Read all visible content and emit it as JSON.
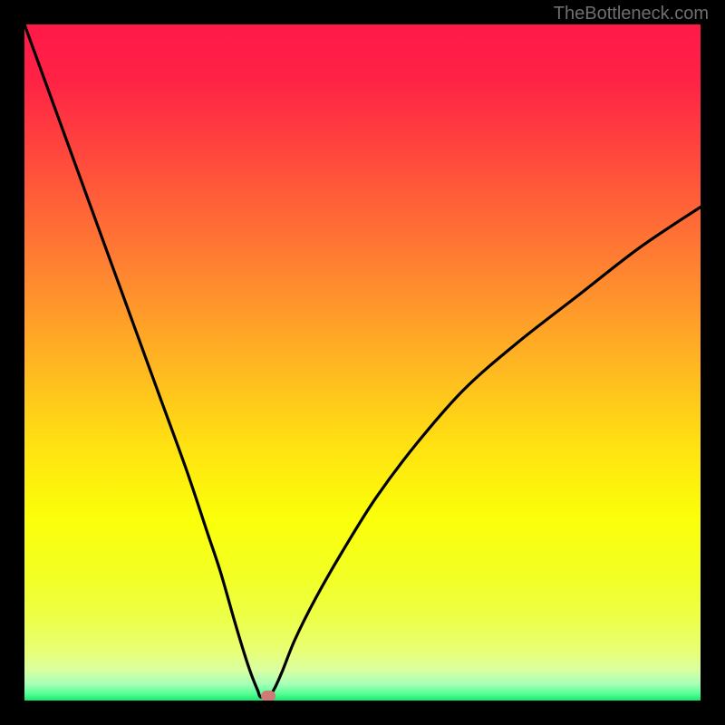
{
  "watermark": "TheBottleneck.com",
  "chart_data": {
    "type": "line",
    "title": "",
    "xlabel": "",
    "ylabel": "",
    "xlim": [
      0,
      100
    ],
    "ylim": [
      0,
      100
    ],
    "grid": false,
    "legend": false,
    "gradient_stops": [
      {
        "offset": 0.0,
        "color": "#ff1948"
      },
      {
        "offset": 0.08,
        "color": "#ff2246"
      },
      {
        "offset": 0.2,
        "color": "#ff4a3c"
      },
      {
        "offset": 0.35,
        "color": "#ff7f32"
      },
      {
        "offset": 0.5,
        "color": "#ffb522"
      },
      {
        "offset": 0.63,
        "color": "#ffe411"
      },
      {
        "offset": 0.73,
        "color": "#fbff09"
      },
      {
        "offset": 0.82,
        "color": "#f2ff26"
      },
      {
        "offset": 0.88,
        "color": "#ecff4a"
      },
      {
        "offset": 0.925,
        "color": "#e9ff73"
      },
      {
        "offset": 0.955,
        "color": "#d9ffa0"
      },
      {
        "offset": 0.975,
        "color": "#a8ffb7"
      },
      {
        "offset": 0.99,
        "color": "#55ff95"
      },
      {
        "offset": 1.0,
        "color": "#17e86e"
      }
    ],
    "series": [
      {
        "name": "bottleneck-curve",
        "optimum_x": 35,
        "x": [
          0,
          4,
          8,
          12,
          16,
          20,
          24,
          27,
          29,
          31,
          32.5,
          33.5,
          34.5,
          35,
          36.5,
          38,
          40,
          43,
          47,
          52,
          58,
          65,
          73,
          82,
          91,
          100
        ],
        "y": [
          100,
          89,
          78,
          67,
          56,
          45,
          34,
          25,
          19,
          12,
          7,
          4,
          1.5,
          0.5,
          1,
          4,
          9,
          15,
          22,
          30,
          38,
          46,
          53,
          60,
          67,
          73
        ]
      }
    ],
    "marker": {
      "x": 36,
      "y": 0.7,
      "color": "#cf7a77"
    }
  }
}
